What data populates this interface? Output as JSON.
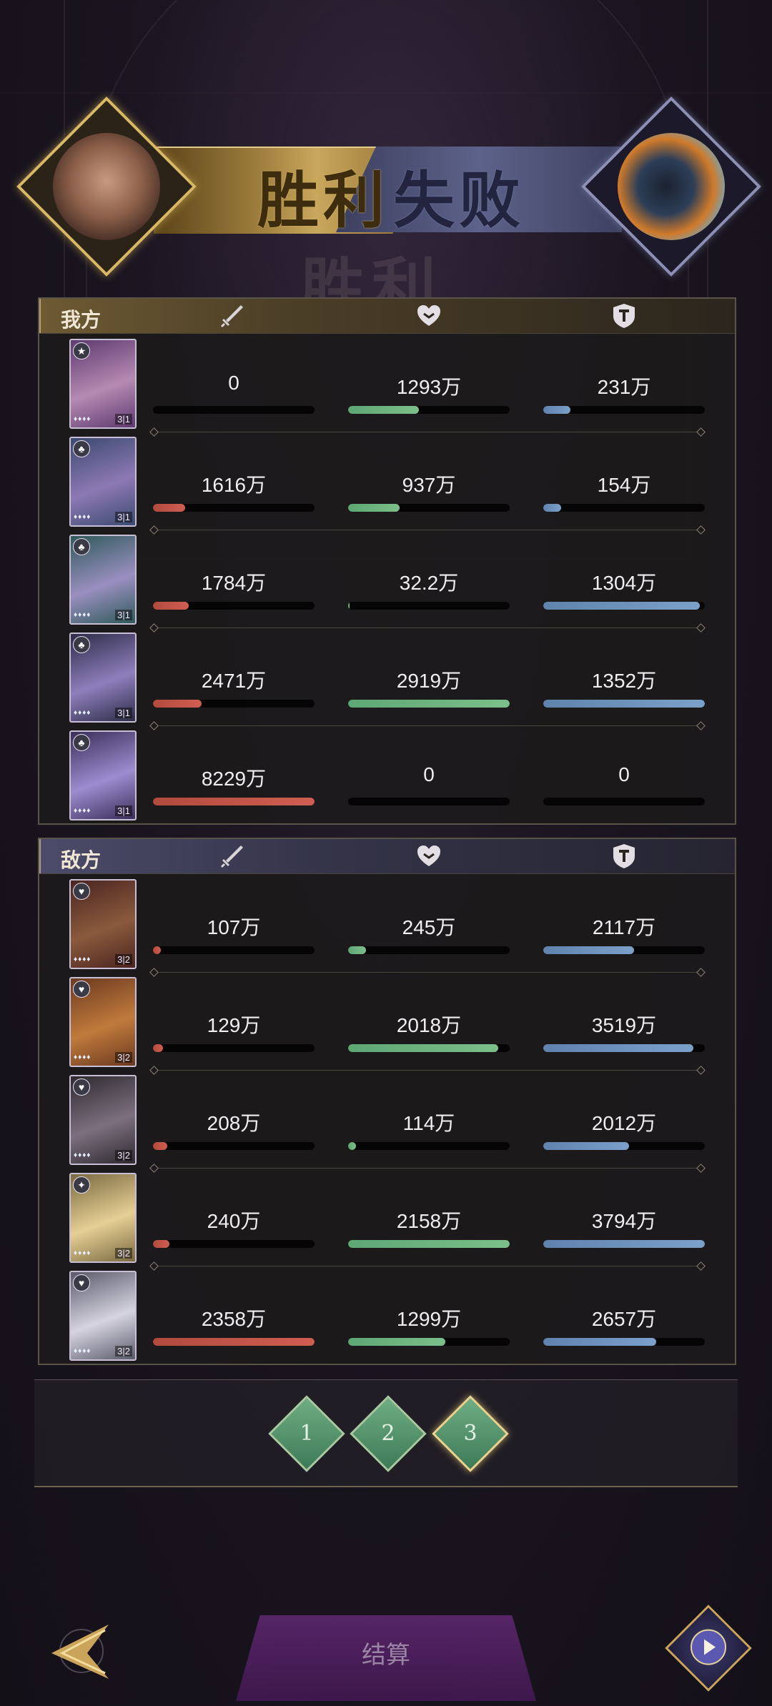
{
  "banner": {
    "win_label": "胜利",
    "lose_label": "失败",
    "ghost_label": "胜利",
    "left_avatar": "boar-warrior",
    "right_avatar": "raven-sorcerer"
  },
  "panels": {
    "mine": {
      "label": "我方",
      "rows": [
        {
          "attack": "0",
          "attack_pct": 0,
          "heal": "1293万",
          "heal_pct": 0.44,
          "tank": "231万",
          "tank_pct": 0.17,
          "rank": "3|1",
          "badge": "★",
          "colors": [
            "#5d3a6f",
            "#b58ab2"
          ]
        },
        {
          "attack": "1616万",
          "attack_pct": 0.2,
          "heal": "937万",
          "heal_pct": 0.32,
          "tank": "154万",
          "tank_pct": 0.11,
          "rank": "3|1",
          "badge": "♣",
          "colors": [
            "#3b4a70",
            "#8d79b4"
          ]
        },
        {
          "attack": "1784万",
          "attack_pct": 0.22,
          "heal": "32.2万",
          "heal_pct": 0.01,
          "tank": "1304万",
          "tank_pct": 0.97,
          "rank": "3|1",
          "badge": "♣",
          "colors": [
            "#2f5a5a",
            "#9a8fc0"
          ]
        },
        {
          "attack": "2471万",
          "attack_pct": 0.3,
          "heal": "2919万",
          "heal_pct": 1.0,
          "tank": "1352万",
          "tank_pct": 1.0,
          "rank": "3|1",
          "badge": "♣",
          "colors": [
            "#2d2c47",
            "#8e7fbc"
          ]
        },
        {
          "attack": "8229万",
          "attack_pct": 1.0,
          "heal": "0",
          "heal_pct": 0,
          "tank": "0",
          "tank_pct": 0,
          "rank": "3|1",
          "badge": "♣",
          "colors": [
            "#3a2f58",
            "#9d8cd0"
          ]
        }
      ]
    },
    "enemy": {
      "label": "敌方",
      "rows": [
        {
          "attack": "107万",
          "attack_pct": 0.05,
          "heal": "245万",
          "heal_pct": 0.11,
          "tank": "2117万",
          "tank_pct": 0.56,
          "rank": "3|2",
          "badge": "♥",
          "colors": [
            "#4a2520",
            "#8a5a3c"
          ]
        },
        {
          "attack": "129万",
          "attack_pct": 0.06,
          "heal": "2018万",
          "heal_pct": 0.93,
          "tank": "3519万",
          "tank_pct": 0.93,
          "rank": "3|2",
          "badge": "♥",
          "colors": [
            "#6b3a1f",
            "#c07a3c"
          ]
        },
        {
          "attack": "208万",
          "attack_pct": 0.09,
          "heal": "114万",
          "heal_pct": 0.05,
          "tank": "2012万",
          "tank_pct": 0.53,
          "rank": "3|2",
          "badge": "♥",
          "colors": [
            "#2d2a2f",
            "#7d6f7f"
          ]
        },
        {
          "attack": "240万",
          "attack_pct": 0.1,
          "heal": "2158万",
          "heal_pct": 1.0,
          "tank": "3794万",
          "tank_pct": 1.0,
          "rank": "3|2",
          "badge": "✦",
          "colors": [
            "#7a6a40",
            "#e6cf95"
          ]
        },
        {
          "attack": "2358万",
          "attack_pct": 1.0,
          "heal": "1299万",
          "heal_pct": 0.6,
          "tank": "2657万",
          "tank_pct": 0.7,
          "rank": "3|2",
          "badge": "♥",
          "colors": [
            "#5a5a6a",
            "#d6d4e0"
          ]
        }
      ]
    }
  },
  "stat_icons": [
    "sword-icon",
    "heart-icon",
    "shield-icon"
  ],
  "rounds": [
    "1",
    "2",
    "3"
  ],
  "active_round": "3",
  "footer": {
    "confirm_label": "结算"
  }
}
